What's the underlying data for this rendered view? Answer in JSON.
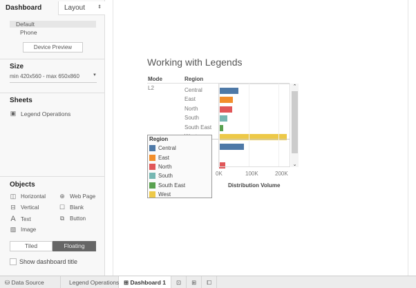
{
  "left_panel": {
    "tabs": {
      "dashboard": "Dashboard",
      "layout": "Layout"
    },
    "devices": [
      "Default",
      "Phone"
    ],
    "device_preview": "Device Preview",
    "size": {
      "title": "Size",
      "value": "min 420x560 - max 650x860"
    },
    "sheets": {
      "title": "Sheets",
      "items": [
        "Legend Operations"
      ]
    },
    "objects": {
      "title": "Objects",
      "items": [
        "Horizontal",
        "Web Page",
        "Vertical",
        "Blank",
        "Text",
        "Button",
        "Image"
      ]
    },
    "layout_mode": {
      "tiled": "Tiled",
      "floating": "Floating",
      "selected": "Floating"
    },
    "show_title": {
      "label": "Show dashboard title",
      "checked": false
    }
  },
  "bottom_tabs": [
    "Data Source",
    "Legend Operations",
    "Dashboard 1"
  ],
  "active_tab": "Dashboard 1",
  "dashboard": {
    "title": "Working with Legends",
    "headers": {
      "mode": "Mode",
      "region": "Region"
    },
    "mode_value": "L2",
    "axis_title": "Distribution Volume",
    "legend": {
      "title": "Region",
      "items": [
        {
          "label": "Central",
          "color": "#4e79a7"
        },
        {
          "label": "East",
          "color": "#f28e2b"
        },
        {
          "label": "North",
          "color": "#e15759"
        },
        {
          "label": "South",
          "color": "#76b7b2"
        },
        {
          "label": "South East",
          "color": "#59a14f"
        },
        {
          "label": "West",
          "color": "#edc948"
        }
      ]
    }
  },
  "chart_data": {
    "type": "bar",
    "xlabel": "Distribution Volume",
    "xlim": [
      0,
      240000
    ],
    "ticks": [
      "0K",
      "100K",
      "200K"
    ],
    "tick_values": [
      0,
      100000,
      200000
    ],
    "groups": [
      {
        "mode": "L2",
        "categories": [
          "Central",
          "East",
          "North",
          "South",
          "South East",
          "West"
        ],
        "values": [
          65000,
          47000,
          44000,
          28000,
          14000,
          228000
        ]
      },
      {
        "mode": "",
        "categories": [
          "Central",
          "East",
          "North"
        ],
        "values": [
          84000,
          2000,
          21000
        ]
      }
    ]
  }
}
